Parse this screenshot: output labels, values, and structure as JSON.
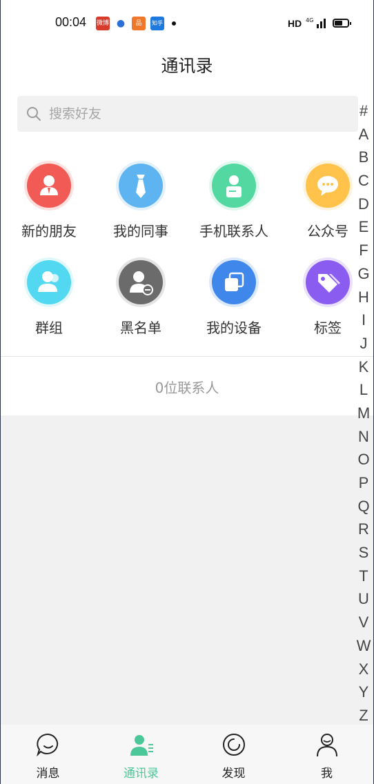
{
  "status_bar": {
    "time": "00:04",
    "notifications": [
      "微博",
      "",
      "品",
      "知乎"
    ],
    "hd": "HD",
    "network": "4G"
  },
  "header": {
    "title": "通讯录"
  },
  "search": {
    "placeholder": "搜索好友",
    "value": ""
  },
  "entries": [
    {
      "label": "新的朋友",
      "icon": "new-friend-icon",
      "color": "#f25a55"
    },
    {
      "label": "我的同事",
      "icon": "tie-icon",
      "color": "#5eb4f0"
    },
    {
      "label": "手机联系人",
      "icon": "phone-contact-icon",
      "color": "#52d8a0"
    },
    {
      "label": "公众号",
      "icon": "chat-bubble-icon",
      "color": "#ffc24a"
    },
    {
      "label": "群组",
      "icon": "group-icon",
      "color": "#52d8f0"
    },
    {
      "label": "黑名单",
      "icon": "blacklist-icon",
      "color": "#6b6b6b"
    },
    {
      "label": "我的设备",
      "icon": "device-icon",
      "color": "#3f87ea"
    },
    {
      "label": "标签",
      "icon": "tag-icon",
      "color": "#8b5cf0"
    }
  ],
  "contact_count": "0位联系人",
  "alphabet": [
    "#",
    "A",
    "B",
    "C",
    "D",
    "E",
    "F",
    "G",
    "H",
    "I",
    "J",
    "K",
    "L",
    "M",
    "N",
    "O",
    "P",
    "Q",
    "R",
    "S",
    "T",
    "U",
    "V",
    "W",
    "X",
    "Y",
    "Z"
  ],
  "tabbar": {
    "items": [
      {
        "label": "消息",
        "icon": "message-icon",
        "active": false
      },
      {
        "label": "通讯录",
        "icon": "contacts-icon",
        "active": true
      },
      {
        "label": "发现",
        "icon": "discover-icon",
        "active": false
      },
      {
        "label": "我",
        "icon": "profile-icon",
        "active": false
      }
    ],
    "active_color": "#4cc79a"
  }
}
